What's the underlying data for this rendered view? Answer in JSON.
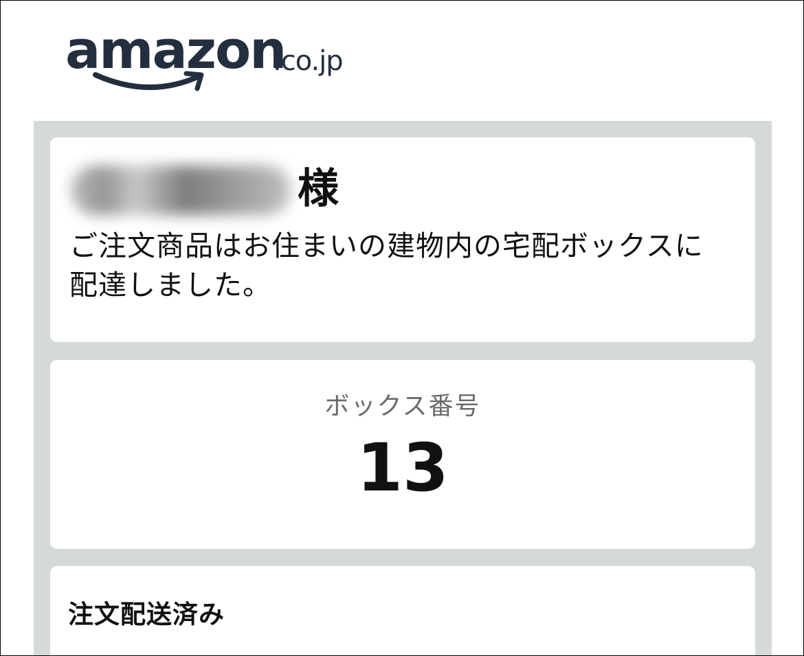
{
  "logo": {
    "wordmark": "amazon",
    "suffix": ".co.jp",
    "color": "#232f3e",
    "smile_color": "#232f3e"
  },
  "greeting": {
    "honorific": "様"
  },
  "message": "ご注文商品はお住まいの建物内の宅配ボックスに配達しました。",
  "box": {
    "label": "ボックス番号",
    "number": "13"
  },
  "status": {
    "title": "注文配送済み"
  },
  "colors": {
    "panel_background": "#d5d9d9",
    "card_background": "#ffffff",
    "text": "#111111",
    "muted_text": "#6b6b6b"
  }
}
